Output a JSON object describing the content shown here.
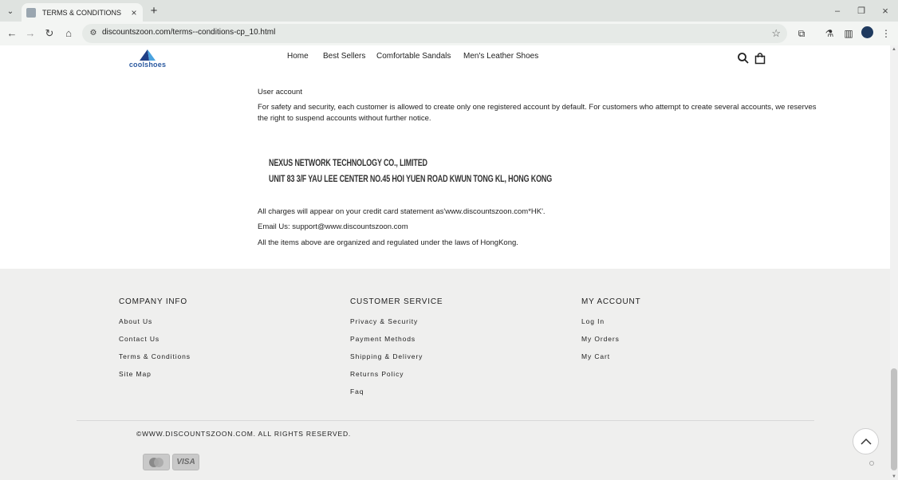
{
  "browser": {
    "tab_title": "TERMS & CONDITIONS",
    "url": "discountszoon.com/terms--conditions-cp_10.html"
  },
  "site": {
    "logo_text": "coolshoes",
    "nav": [
      "Home",
      "Best Sellers",
      "Comfortable Sandals",
      "Men's Leather Shoes"
    ]
  },
  "content": {
    "section_title": "User account",
    "section_body": "For safety and security, each customer is allowed to create only one registered account by default. For customers who attempt to create several accounts, we reserves the right to suspend accounts without further notice.",
    "company_name": "NEXUS NETWORK TECHNOLOGY CO., LIMITED",
    "company_address": "UNIT 83 3/F YAU LEE CENTER NO.45 HOI YUEN ROAD KWUN TONG KL, HONG KONG",
    "charges": "All charges will appear on your credit card statement as'www.discountszoon.com*HK'.",
    "email": "Email Us: support@www.discountszoon.com",
    "laws": "All the items above are organized and regulated under the laws of HongKong."
  },
  "footer": {
    "company_info": {
      "heading": "COMPANY INFO",
      "links": [
        "About Us",
        "Contact Us",
        "Terms & Conditions",
        "Site Map"
      ]
    },
    "customer_service": {
      "heading": "CUSTOMER SERVICE",
      "links": [
        "Privacy & Security",
        "Payment Methods",
        "Shipping & Delivery",
        "Returns Policy",
        "Faq"
      ]
    },
    "my_account": {
      "heading": "MY ACCOUNT",
      "links": [
        "Log In",
        "My Orders",
        "My Cart"
      ]
    },
    "copyright": "©WWW.DISCOUNTSZOON.COM. ALL RIGHTS RESERVED.",
    "payment": [
      "mastercard",
      "VISA"
    ]
  }
}
